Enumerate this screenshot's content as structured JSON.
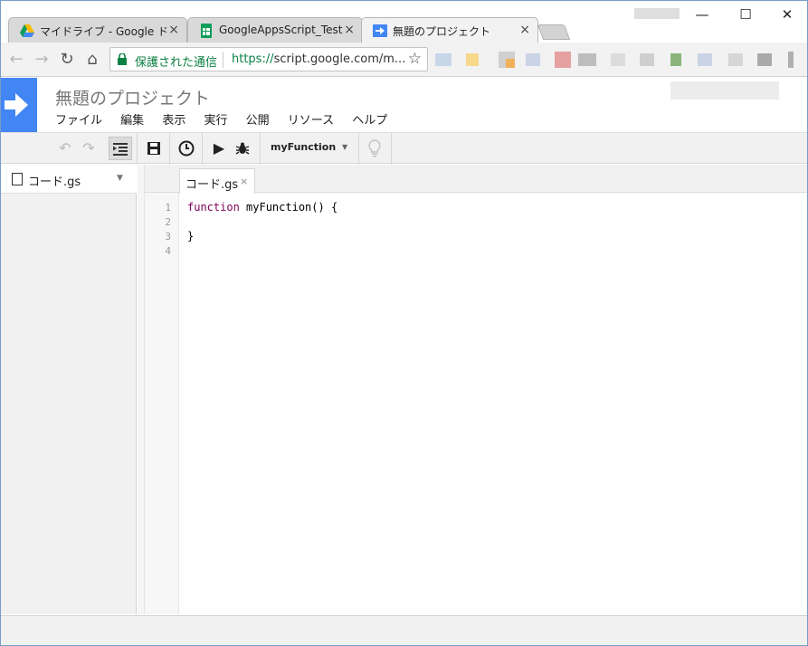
{
  "browser": {
    "tabs": [
      {
        "title": "マイドライブ - Google ドライ",
        "close": "×",
        "icon": "google-drive-icon"
      },
      {
        "title": "GoogleAppsScript_Test -",
        "close": "×",
        "icon": "google-sheets-icon"
      },
      {
        "title": "無題のプロジェクト",
        "close": "×",
        "icon": "apps-script-icon"
      }
    ],
    "window_controls": {
      "minimize": "—",
      "maximize": "☐",
      "close": "✕"
    },
    "omnibox": {
      "security_label": "保護された通信",
      "url_scheme": "https://",
      "url_rest": "script.google.com/m..."
    }
  },
  "app": {
    "project_name": "無題のプロジェクト",
    "menu": [
      "ファイル",
      "編集",
      "表示",
      "実行",
      "公開",
      "リソース",
      "ヘルプ"
    ],
    "toolbar": {
      "function_select": "myFunction"
    },
    "files": [
      {
        "name": "コード.gs"
      }
    ],
    "editor": {
      "tab_label": "コード.gs",
      "tab_close": "×",
      "line_numbers": [
        "1",
        "2",
        "3",
        "4"
      ],
      "lines": {
        "line1_keyword": "function",
        "line1_rest": " myFunction() {",
        "line3": "}"
      }
    }
  },
  "colors": {
    "brand": "#4285f4",
    "secure_green": "#0b8043"
  }
}
